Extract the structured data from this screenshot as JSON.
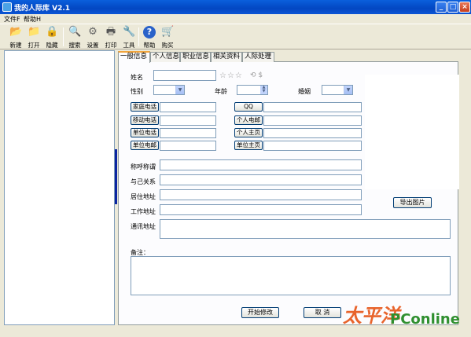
{
  "window": {
    "title": "我的人际库 V2.1"
  },
  "menu": [
    {
      "label": "文件F"
    },
    {
      "label": "帮助H"
    }
  ],
  "toolbar": [
    {
      "label": "新建",
      "icon": "folder-new-icon",
      "glyph": "📂"
    },
    {
      "label": "打开",
      "icon": "folder-open-icon",
      "glyph": "📁"
    },
    {
      "label": "隐藏",
      "icon": "lock-icon",
      "glyph": "🔒"
    },
    {
      "label": "搜索",
      "icon": "search-icon",
      "glyph": "🔍"
    },
    {
      "label": "设置",
      "icon": "gear-icon",
      "glyph": "⚙"
    },
    {
      "label": "打印",
      "icon": "printer-icon",
      "glyph": "🖶"
    },
    {
      "label": "工具",
      "icon": "wrench-icon",
      "glyph": "🔧"
    },
    {
      "label": "帮助",
      "icon": "help-icon",
      "glyph": "?"
    },
    {
      "label": "购买",
      "icon": "cart-icon",
      "glyph": "🛒"
    }
  ],
  "tabs": [
    {
      "label": "一般信息",
      "active": true
    },
    {
      "label": "个人信息"
    },
    {
      "label": "职业信息"
    },
    {
      "label": "相关资料"
    },
    {
      "label": "人际处理"
    }
  ],
  "form": {
    "name_label": "姓名",
    "gender_label": "性别",
    "age_label": "年龄",
    "marriage_label": "婚姻",
    "phone_buttons": [
      "家庭电话",
      "移动电话",
      "单位电话",
      "单位电邮"
    ],
    "contact_buttons": [
      "QQ",
      "个人电邮",
      "个人主页",
      "单位主页"
    ],
    "title_label": "称呼称谓",
    "relation_label": "与己关系",
    "home_address_label": "居住地址",
    "work_address_label": "工作地址",
    "mail_address_label": "通讯地址",
    "notes_label": "备注：",
    "export_photo_button": "导出图片",
    "start_edit_button": "开始修改",
    "cancel_button": "取 消"
  },
  "watermark": {
    "text": "太平洋",
    "sub": "PConline"
  },
  "colors": {
    "titlebar": "#0347c2",
    "tab_active_border": "#f1a43c",
    "input_border": "#7f9db9"
  }
}
